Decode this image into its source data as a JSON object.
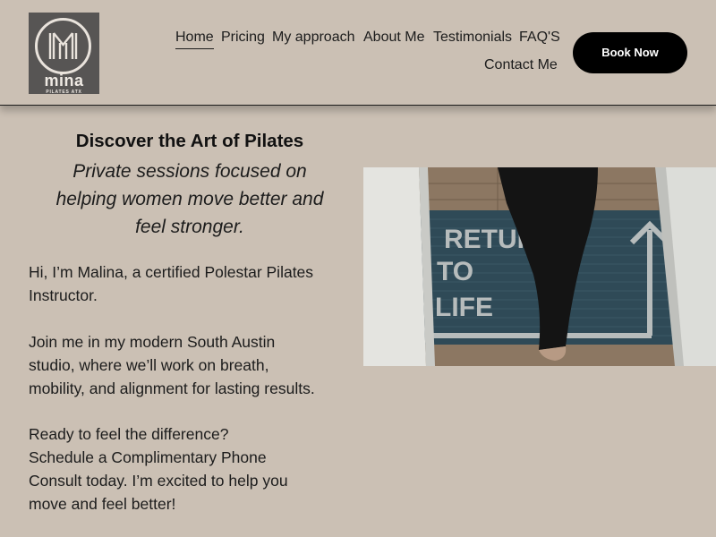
{
  "brand": {
    "logo_word": "mina",
    "logo_sub": "PILATES ATX"
  },
  "nav": {
    "items": [
      {
        "label": "Home",
        "active": true
      },
      {
        "label": "Pricing",
        "active": false
      },
      {
        "label": "My approach",
        "active": false
      },
      {
        "label": "About Me",
        "active": false
      },
      {
        "label": "Testimonials",
        "active": false
      },
      {
        "label": "FAQ'S",
        "active": false
      },
      {
        "label": "Contact Me",
        "active": false
      }
    ],
    "cta_label": "Book Now"
  },
  "hero": {
    "title": "Discover the Art of Pilates",
    "subtitle_lines": [
      "Private sessions focused on",
      "helping women move better and",
      "feel stronger."
    ],
    "paragraphs": [
      [
        "Hi, I’m Malina, a certified Polestar Pilates",
        "Instructor."
      ],
      [
        "Join me in my modern South Austin",
        "studio, where we’ll work on breath,",
        "mobility, and alignment for lasting results."
      ],
      [
        "Ready to feel the difference?",
        "Schedule a Complimentary Phone",
        "Consult today. I’m excited to help you",
        "move and feel better!"
      ]
    ]
  },
  "image": {
    "mat_text_lines": [
      "RETURN",
      "TO",
      "LIFE"
    ]
  },
  "colors": {
    "background": "#cbc0b4",
    "text": "#1c1c1c",
    "button_bg": "#000000",
    "button_text": "#ffffff",
    "logo_bg": "#575554",
    "mat": "#2f4a57"
  }
}
